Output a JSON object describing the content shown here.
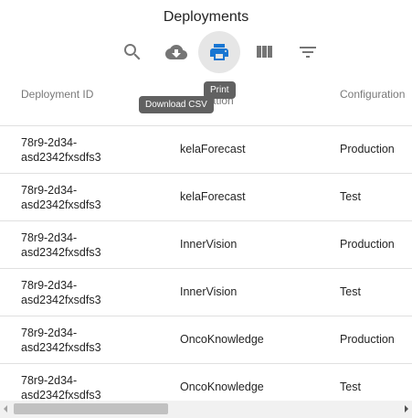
{
  "title": "Deployments",
  "toolbar": {
    "buttons": [
      {
        "name": "search",
        "icon": "search-icon"
      },
      {
        "name": "download",
        "icon": "cloud-download-icon"
      },
      {
        "name": "print",
        "icon": "print-icon"
      },
      {
        "name": "columns",
        "icon": "view-column-icon"
      },
      {
        "name": "filter",
        "icon": "filter-list-icon"
      }
    ],
    "active_color": "#1976d2",
    "tooltip_print": "Print",
    "tooltip_download": "Download CSV"
  },
  "table": {
    "headers": {
      "deployment_id": "Deployment ID",
      "application": "Application",
      "configuration": "Configuration"
    },
    "rows": [
      {
        "id_line1": "78r9-2d34-",
        "id_line2": "asd2342fxsdfs3",
        "application": "kelaForecast",
        "configuration": "Production"
      },
      {
        "id_line1": "78r9-2d34-",
        "id_line2": "asd2342fxsdfs3",
        "application": "kelaForecast",
        "configuration": "Test"
      },
      {
        "id_line1": "78r9-2d34-",
        "id_line2": "asd2342fxsdfs3",
        "application": "InnerVision",
        "configuration": "Production"
      },
      {
        "id_line1": "78r9-2d34-",
        "id_line2": "asd2342fxsdfs3",
        "application": "InnerVision",
        "configuration": "Test"
      },
      {
        "id_line1": "78r9-2d34-",
        "id_line2": "asd2342fxsdfs3",
        "application": "OncoKnowledge",
        "configuration": "Production"
      },
      {
        "id_line1": "78r9-2d34-",
        "id_line2": "asd2342fxsdfs3",
        "application": "OncoKnowledge",
        "configuration": "Test"
      }
    ]
  }
}
